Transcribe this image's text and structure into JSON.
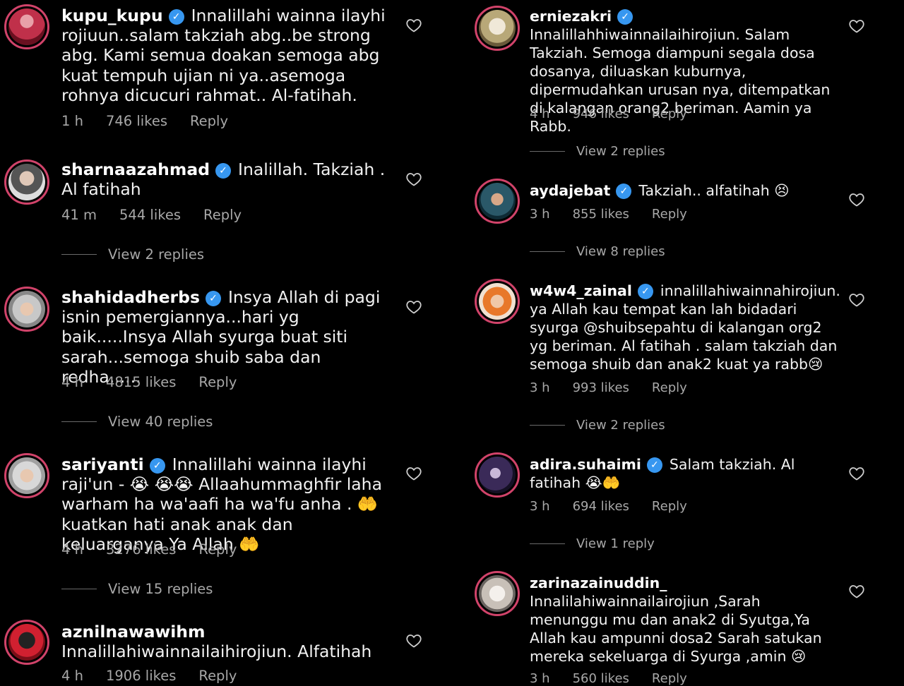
{
  "colors": {
    "background": "#000000",
    "text": "#f2f2f2",
    "muted": "#a8a8a8",
    "verified": "#3797f0",
    "avatar_ring": "#d1436a"
  },
  "left": [
    {
      "username": "kupu_kupu",
      "verified": true,
      "text": "Innalillahi wainna ilayhi rojiuun..salam takziah abg..be strong abg. Kami semua doakan semoga abg kuat tempuh ujian ni ya..asemoga rohnya dicucuri rahmat.. Al-fatihah.",
      "time": "1 h",
      "likes": "746 likes",
      "reply": "Reply",
      "view_replies": ""
    },
    {
      "username": "sharnaazahmad",
      "verified": true,
      "text": "Inalillah. Takziah . Al fatihah",
      "time": "41 m",
      "likes": "544 likes",
      "reply": "Reply",
      "view_replies": "View 2 replies"
    },
    {
      "username": "shahidadherbs",
      "verified": true,
      "text": "Insya Allah di pagi isnin pemergiannya...hari yg baik.....Insya Allah syurga buat siti sarah...semoga shuib saba dan redha......",
      "time": "4 h",
      "likes": "4815 likes",
      "reply": "Reply",
      "view_replies": "View 40 replies"
    },
    {
      "username": "sariyanti",
      "verified": true,
      "text": "Innalillahi wainna ilayhi raji'un - 😭 😭😭 Allaahummaghfir laha warham ha wa'aafi ha wa'fu anha . 🤲 kuatkan hati anak anak dan keluarganya Ya Allah 🤲",
      "time": "4 h",
      "likes": "3276 likes",
      "reply": "Reply",
      "view_replies": "View 15 replies"
    },
    {
      "username": "aznilnawawihm",
      "verified": false,
      "text": "Innalillahiwainnailaihirojiun. Alfatihah",
      "time": "4 h",
      "likes": "1906 likes",
      "reply": "Reply",
      "view_replies": ""
    }
  ],
  "right": [
    {
      "username": "erniezakri",
      "verified": true,
      "text": "Innalillahhiwainnailaihirojiun. Salam Takziah. Semoga diampuni segala dosa dosanya, diluaskan kuburnya, dipermudahkan urusan nya, ditempatkan di kalangan orang2 beriman. Aamin ya Rabb.",
      "time": "4 h",
      "likes": "946 likes",
      "reply": "Reply",
      "view_replies": "View 2 replies"
    },
    {
      "username": "aydajebat",
      "verified": true,
      "text": "Takziah.. alfatihah 😣",
      "time": "3 h",
      "likes": "855 likes",
      "reply": "Reply",
      "view_replies": "View 8 replies"
    },
    {
      "username": "w4w4_zainal",
      "verified": true,
      "text": "innalillahiwainnahirojiun. ya Allah kau tempat kan lah bidadari syurga @shuibsepahtu di kalangan org2 yg beriman. Al fatihah . salam takziah dan semoga shuib dan anak2 kuat ya rabb😢",
      "time": "3 h",
      "likes": "993 likes",
      "reply": "Reply",
      "view_replies": "View 2 replies"
    },
    {
      "username": "adira.suhaimi",
      "verified": true,
      "text": "Salam takziah. Al fatihah 😭🤲",
      "time": "3 h",
      "likes": "694 likes",
      "reply": "Reply",
      "view_replies": "View 1 reply"
    },
    {
      "username": "zarinazainuddin_",
      "verified": false,
      "text": "Innalilahiwainnailairojiun ,Sarah menunggu mu dan anak2 di Syutga,Ya Allah kau ampunni dosa2 Sarah satukan mereka sekeluarga di Syurga ,amin 😢",
      "time": "3 h",
      "likes": "560 likes",
      "reply": "Reply",
      "view_replies": ""
    }
  ]
}
